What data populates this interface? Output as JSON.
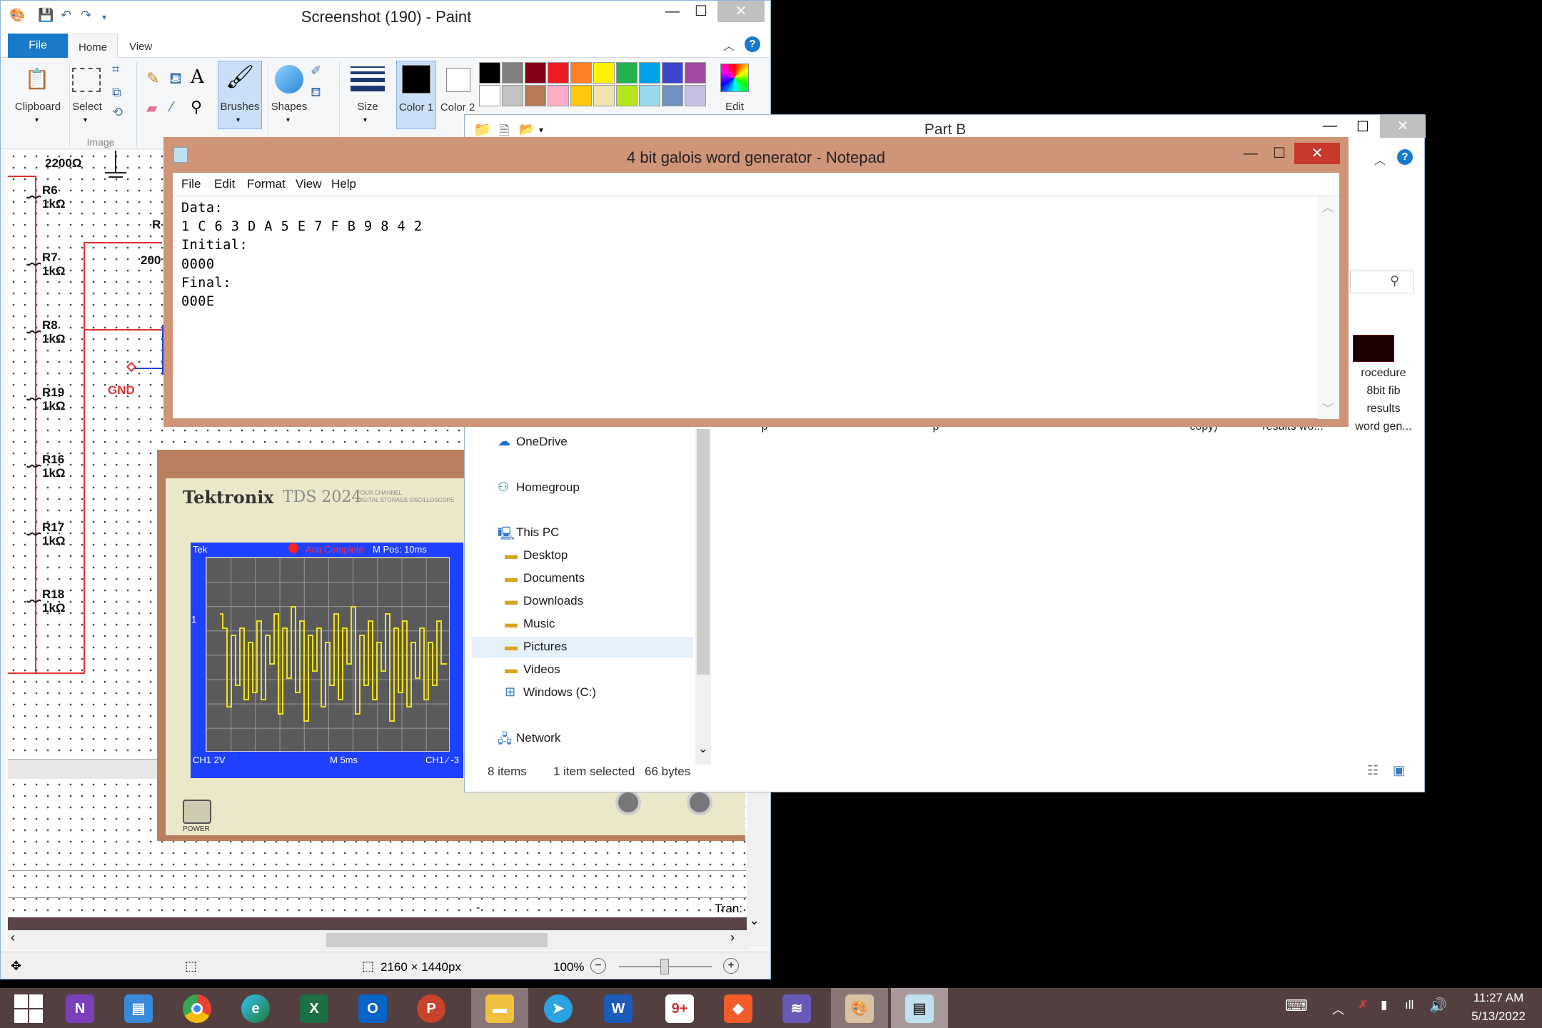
{
  "paint": {
    "title": "Screenshot (190) - Paint",
    "tabs": {
      "file": "File",
      "home": "Home",
      "view": "View"
    },
    "groups": {
      "clipboard": "Clipboard",
      "select": "Select",
      "image": "Image",
      "brushes": "Brushes",
      "shapes": "Shapes",
      "size": "Size",
      "color1": "Color 1",
      "color2": "Color 2",
      "edit_colors": "Edit colors"
    },
    "palette_row1": [
      "#000000",
      "#7f7f7f",
      "#880015",
      "#ed1c24",
      "#ff7f27",
      "#fff200",
      "#22b14c",
      "#00a2e8",
      "#3f48cc",
      "#a349a4"
    ],
    "palette_row2": [
      "#ffffff",
      "#c3c3c3",
      "#b97a57",
      "#ffaec9",
      "#ffc90e",
      "#efe4b0",
      "#b5e61d",
      "#99d9ea",
      "#7092be",
      "#c8bfe7"
    ],
    "status": {
      "dimensions": "2160 × 1440px",
      "zoom": "100%"
    },
    "canvas": {
      "top_label": "2200Ω",
      "resistors": [
        {
          "name": "R6",
          "value": "1kΩ"
        },
        {
          "name": "R7",
          "value": "1kΩ"
        },
        {
          "name": "R8",
          "value": "1kΩ"
        },
        {
          "name": "R19",
          "value": "1kΩ"
        },
        {
          "name": "R16",
          "value": "1kΩ"
        },
        {
          "name": "R17",
          "value": "1kΩ"
        },
        {
          "name": "R18",
          "value": "1kΩ"
        }
      ],
      "partial_label": "R",
      "partial_value": "200",
      "gnd": "GND",
      "tran": "Tran:",
      "dash": "-"
    }
  },
  "scope": {
    "brand": "Tektronix",
    "model": "TDS 2024",
    "model_sub1": "FOUR CHANNEL",
    "model_sub2": "DIGITAL STORAGE OSCILLOSCOPE",
    "tek": "Tek",
    "status": "Acq Complete",
    "mpos": "M Pos: 10ms",
    "ch1": "CH1  2V",
    "timebase": "M 5ms",
    "trig": "CH1 ∕  -3",
    "power": "POWER",
    "marker": "1"
  },
  "explorer": {
    "title": "Part B",
    "nav": [
      {
        "label": "OneDrive",
        "icon": "cloud"
      },
      {
        "label": "Homegroup",
        "icon": "homegroup"
      },
      {
        "label": "This PC",
        "icon": "pc"
      },
      {
        "label": "Desktop",
        "icon": "folder"
      },
      {
        "label": "Documents",
        "icon": "folder"
      },
      {
        "label": "Downloads",
        "icon": "folder"
      },
      {
        "label": "Music",
        "icon": "folder"
      },
      {
        "label": "Pictures",
        "icon": "folder"
      },
      {
        "label": "Videos",
        "icon": "folder"
      },
      {
        "label": "Windows (C:)",
        "icon": "drive"
      },
      {
        "label": "Network",
        "icon": "network"
      }
    ],
    "files": [
      {
        "line1": "p"
      },
      {
        "line1": "p"
      },
      {
        "line1": "copy)"
      },
      {
        "line1": "results wo..."
      },
      {
        "line1": "rocedure",
        "line2": "8bit fib",
        "line3": "results",
        "line4": "word gen..."
      }
    ],
    "status": {
      "items": "8 items",
      "selected": "1 item selected",
      "size": "66 bytes"
    }
  },
  "notepad": {
    "title": "4 bit galois word generator - Notepad",
    "menu": [
      "File",
      "Edit",
      "Format",
      "View",
      "Help"
    ],
    "content": "Data:\n1 C 6 3 D A 5 E 7 F B 9 8 4 2\nInitial:\n0000\nFinal:\n000E"
  },
  "taskbar": {
    "apps": [
      "start",
      "onenote",
      "remote-desktop",
      "chrome",
      "edge",
      "excel",
      "outlook",
      "powerpoint",
      "file-explorer",
      "telegram",
      "word",
      "documents",
      "brave",
      "multisim",
      "paint",
      "notepad"
    ],
    "time": "11:27 AM",
    "date": "5/13/2022"
  }
}
